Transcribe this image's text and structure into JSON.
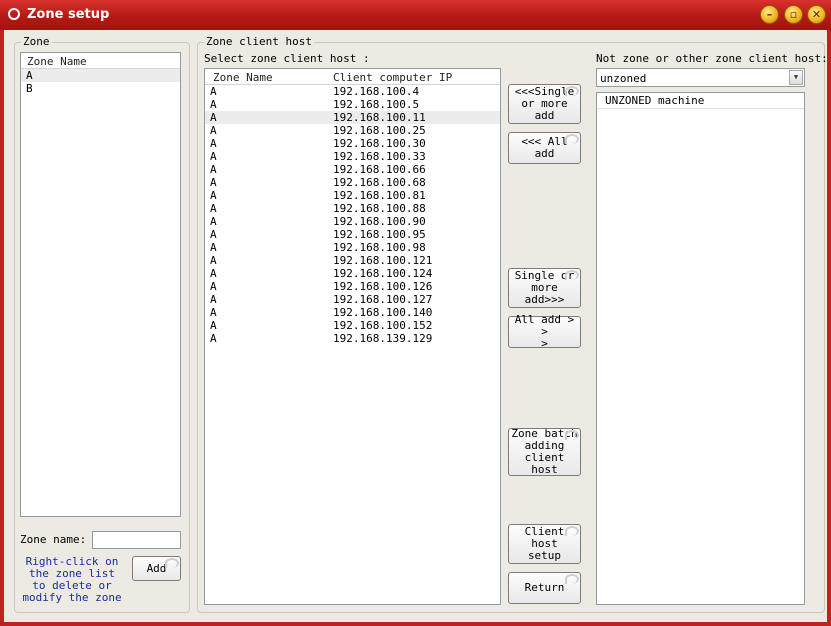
{
  "window": {
    "title": "Zone setup"
  },
  "zone_group": {
    "title": "Zone",
    "list_header": "Zone Name",
    "items": [
      "A",
      "B"
    ],
    "name_label": "Zone name:",
    "name_value": "",
    "hint": "Right-click on the zone list to delete or modify the zone",
    "add_label": "Add"
  },
  "client_group": {
    "title": "Zone client host",
    "select_label": "Select zone client host :",
    "col_zone": "Zone Name",
    "col_ip": "Client computer IP",
    "rows": [
      {
        "zone": "A",
        "ip": "192.168.100.4"
      },
      {
        "zone": "A",
        "ip": "192.168.100.5"
      },
      {
        "zone": "A",
        "ip": "192.168.100.11"
      },
      {
        "zone": "A",
        "ip": "192.168.100.25"
      },
      {
        "zone": "A",
        "ip": "192.168.100.30"
      },
      {
        "zone": "A",
        "ip": "192.168.100.33"
      },
      {
        "zone": "A",
        "ip": "192.168.100.66"
      },
      {
        "zone": "A",
        "ip": "192.168.100.68"
      },
      {
        "zone": "A",
        "ip": "192.168.100.81"
      },
      {
        "zone": "A",
        "ip": "192.168.100.88"
      },
      {
        "zone": "A",
        "ip": "192.168.100.90"
      },
      {
        "zone": "A",
        "ip": "192.168.100.95"
      },
      {
        "zone": "A",
        "ip": "192.168.100.98"
      },
      {
        "zone": "A",
        "ip": "192.168.100.121"
      },
      {
        "zone": "A",
        "ip": "192.168.100.124"
      },
      {
        "zone": "A",
        "ip": "192.168.100.126"
      },
      {
        "zone": "A",
        "ip": "192.168.100.127"
      },
      {
        "zone": "A",
        "ip": "192.168.100.140"
      },
      {
        "zone": "A",
        "ip": "192.168.100.152"
      },
      {
        "zone": "A",
        "ip": "192.168.139.129"
      }
    ],
    "buttons": {
      "single_add_left_1": "<<<Single",
      "single_add_left_2": "or more add",
      "all_add_left": "<<< All add",
      "single_add_right_1": "Single or",
      "single_add_right_2": "more add>>>",
      "all_add_right_1": "All add > >",
      "all_add_right_2": ">",
      "batch_1": "Zone batch",
      "batch_2": "adding",
      "batch_3": "client host",
      "client_setup_1": "Client host",
      "client_setup_2": "setup",
      "return": "Return"
    },
    "other_label": "Not zone or other zone client host:",
    "combo_value": "unzoned",
    "other_items": [
      "UNZONED machine"
    ]
  }
}
